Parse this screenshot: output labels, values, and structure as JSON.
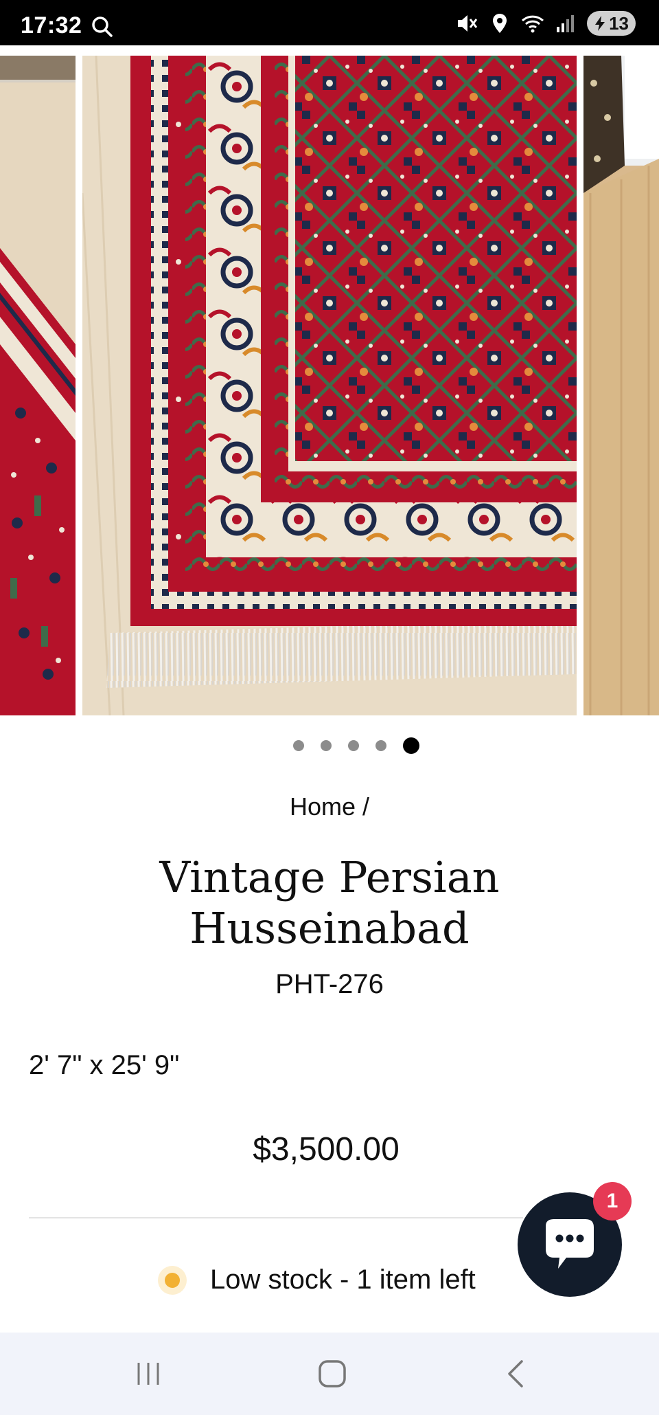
{
  "status_bar": {
    "time": "17:32",
    "battery": "13",
    "icons": [
      "search-icon",
      "mute-icon",
      "location-icon",
      "wifi-icon",
      "signal-icon",
      "battery-icon"
    ]
  },
  "carousel": {
    "total_slides": 5,
    "active_slide": 5,
    "zoom_icon": "magnifier-icon"
  },
  "breadcrumb": {
    "home": "Home",
    "separator": "/"
  },
  "product": {
    "title": "Vintage Persian Husseinabad",
    "sku": "PHT-276",
    "size": "2' 7\" x 25' 9\"",
    "price": "$3,500.00",
    "stock_text": "Low stock - 1 item left"
  },
  "chat": {
    "badge_count": "1"
  },
  "nav_bar": {
    "buttons": [
      "recent-apps-icon",
      "home-icon",
      "back-icon"
    ]
  },
  "colors": {
    "status_bar_bg": "#000000",
    "rug_red": "#b5122a",
    "rug_ivory": "#efe6d6",
    "rug_navy": "#1e2a4a",
    "floor": "#e6d7bf",
    "stock_dot": "#f2b134",
    "chat_bg": "#121c2b",
    "badge": "#e63a55",
    "nav_bg": "#f1f3fa"
  }
}
